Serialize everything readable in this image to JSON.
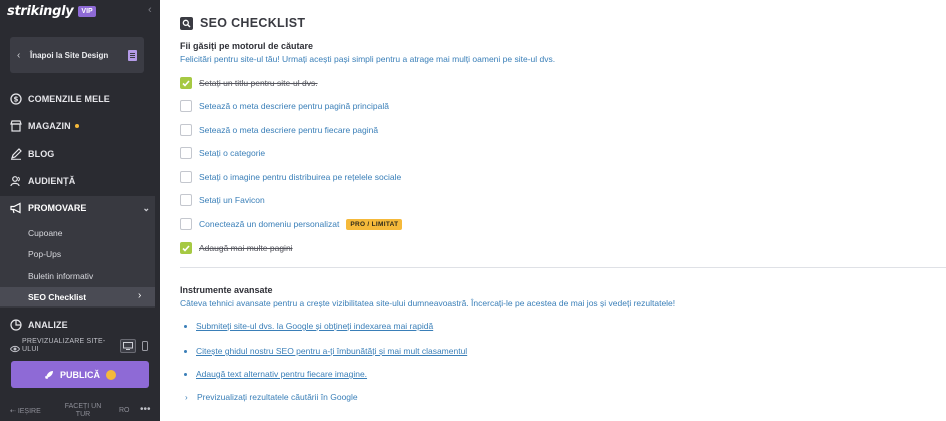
{
  "brand": {
    "name": "strikingly",
    "badge": "VIP"
  },
  "sidebar": {
    "back_label": "Înapoi la Site Design",
    "items": [
      {
        "label": "COMENZILE MELE",
        "icon": "dollar-icon"
      },
      {
        "label": "MAGAZIN",
        "icon": "store-icon"
      },
      {
        "label": "BLOG",
        "icon": "pen-icon"
      },
      {
        "label": "AUDIENȚĂ",
        "icon": "users-icon"
      }
    ],
    "promo": {
      "label": "PROMOVARE",
      "icon": "megaphone-icon",
      "subitems": [
        "Cupoane",
        "Pop-Ups",
        "Buletin informativ",
        "SEO Checklist"
      ]
    },
    "analytics_label": "ANALIZE",
    "preview_label": "PREVIZUALIZARE SITE-ULUI",
    "publish_label": "PUBLICĂ",
    "footer": {
      "exit": "IEȘIRE",
      "tour": "FACEȚI UN TUR",
      "lang": "RO",
      "more": "•••"
    }
  },
  "main": {
    "title": "SEO CHECKLIST",
    "section1": {
      "heading": "Fii găsiți pe motorul de căutare",
      "description": "Felicitări pentru site-ul tău! Urmați acești pași simpli pentru a atrage mai mulți oameni pe site-ul dvs."
    },
    "checklist": [
      {
        "label": "Setați un titlu pentru site-ul dvs.",
        "done": true
      },
      {
        "label": "Setează o meta descriere pentru pagină principală",
        "done": false
      },
      {
        "label": "Setează o meta descriere pentru fiecare pagină",
        "done": false
      },
      {
        "label": "Setați o categorie",
        "done": false
      },
      {
        "label": "Setați o imagine pentru distribuirea pe rețelele sociale",
        "done": false
      },
      {
        "label": "Setați un Favicon",
        "done": false
      },
      {
        "label": "Conectează un domeniu personalizat",
        "done": false,
        "badge": "PRO / LIMITAT"
      },
      {
        "label": "Adaugă mai multe pagini",
        "done": true
      }
    ],
    "section2": {
      "heading": "Instrumente avansate",
      "description": "Câteva tehnici avansate pentru a crește vizibilitatea site-ului dumneavoastră. Încercați-le pe acestea de mai jos și vedeți rezultatele!"
    },
    "links": [
      "Submiteți site-ul dvs. la Google și obțineți indexarea mai rapidă",
      "Citește ghidul nostru SEO pentru a-ți îmbunătăți și mai mult clasamentul",
      "Adaugă text alternativ pentru fiecare imagine."
    ],
    "expand_label": "Previzualizați rezultatele căutării în Google"
  },
  "colors": {
    "sidebar_bg": "#2a2b31",
    "accent": "#8e6ad6",
    "link": "#3a7fb8",
    "check": "#a6c943",
    "pro": "#f5b93a"
  }
}
